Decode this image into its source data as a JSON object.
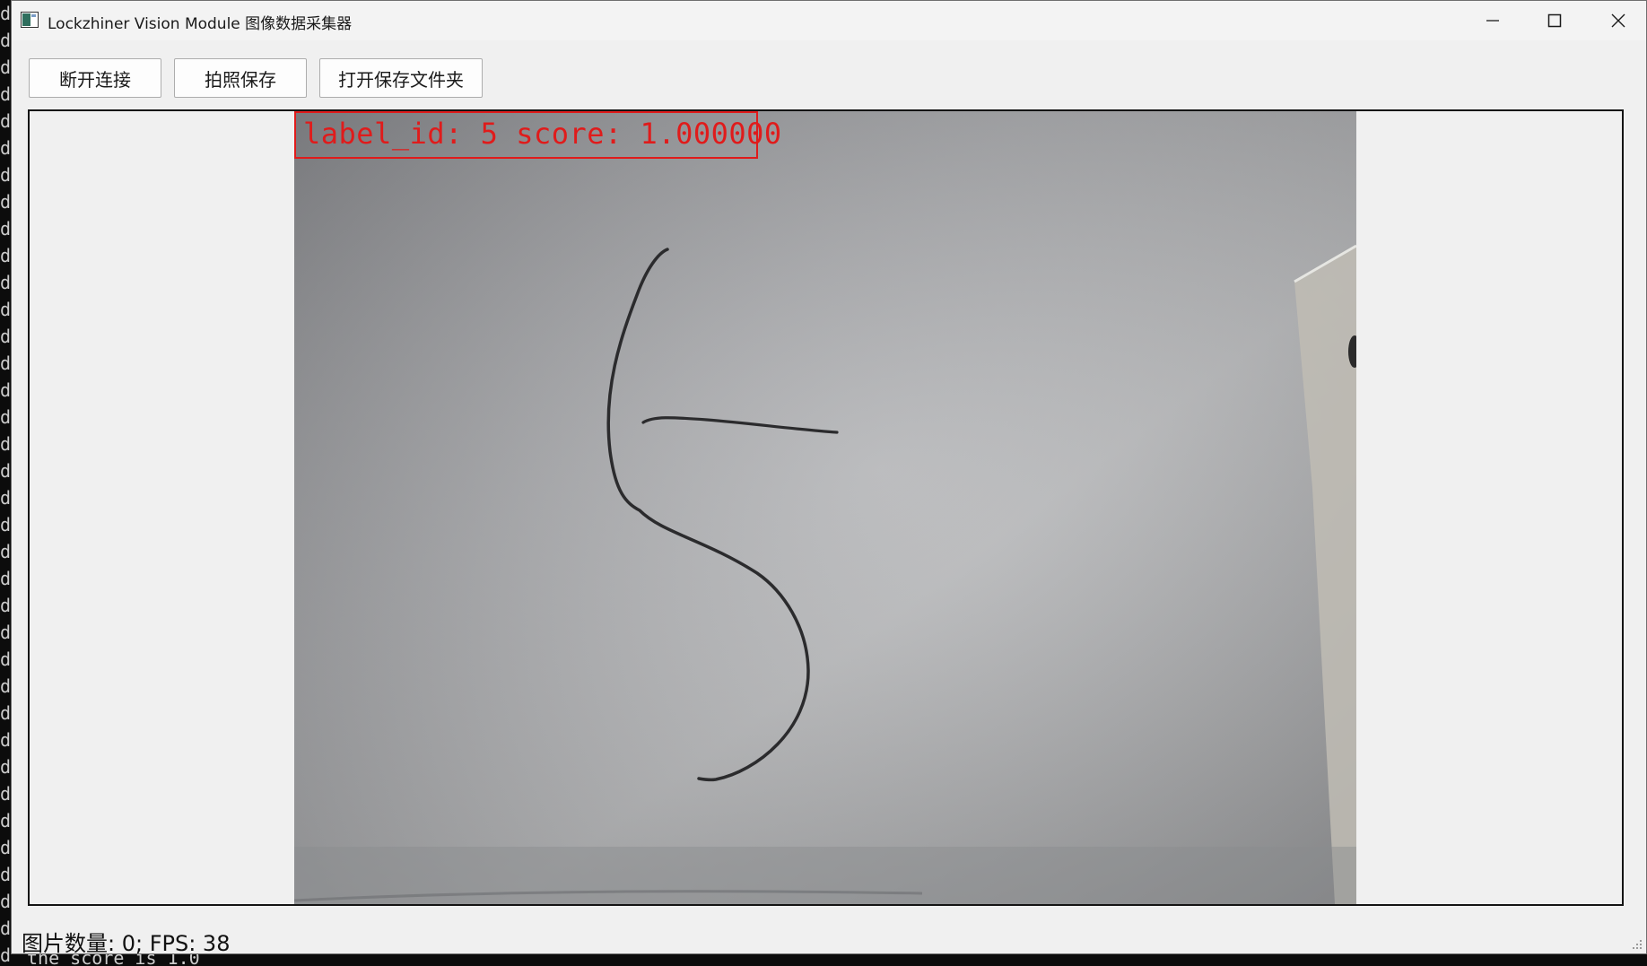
{
  "window": {
    "title": "Lockzhiner Vision Module 图像数据采集器",
    "minimize_icon": "minimize-icon",
    "maximize_icon": "maximize-icon",
    "close_icon": "close-icon"
  },
  "toolbar": {
    "disconnect_label": "断开连接",
    "capture_save_label": "拍照保存",
    "open_folder_label": "打开保存文件夹"
  },
  "detection": {
    "label_text": "label_id: 5 score: 1.000000",
    "box_color": "#e01b1b"
  },
  "status_bar": {
    "text": "图片数量: 0; FPS: 38"
  },
  "terminal": {
    "edge_char": "d",
    "bottom_text": "the score is 1.0"
  }
}
